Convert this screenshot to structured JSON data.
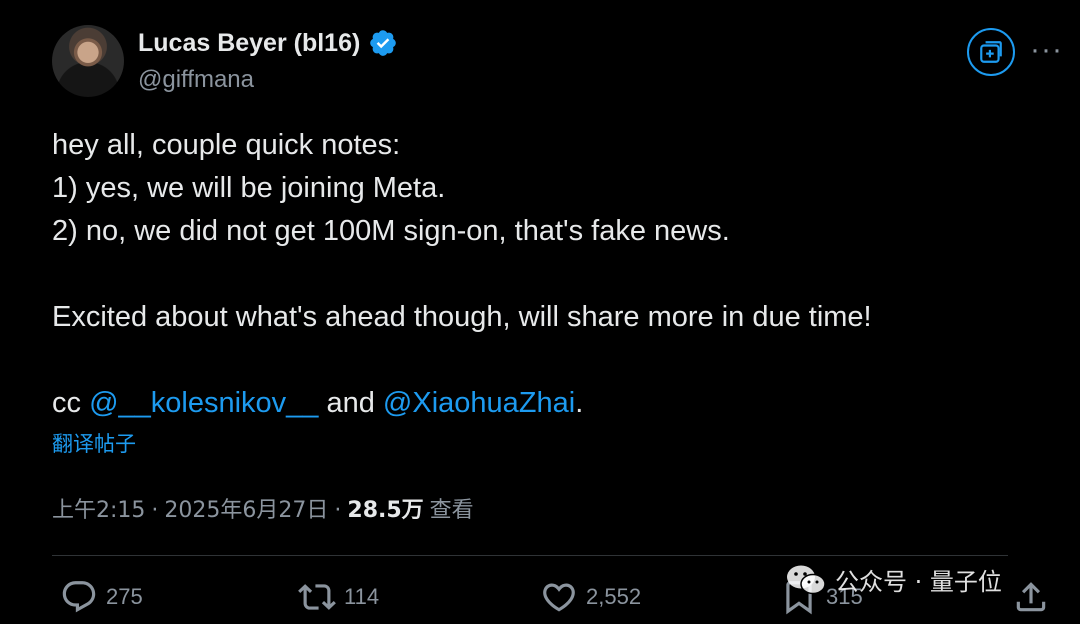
{
  "author": {
    "display_name": "Lucas Beyer (bl16)",
    "handle": "@giffmana"
  },
  "tweet": {
    "line1": "hey all, couple quick notes:",
    "line2": "1) yes, we will be joining Meta.",
    "line3": "2) no, we did not get 100M sign-on, that's fake news.",
    "line5": "Excited about what's ahead though, will share more in due time!",
    "cc_prefix": "cc ",
    "mention1": "@__kolesnikov__",
    "cc_and": " and ",
    "mention2": "@XiaohuaZhai",
    "cc_suffix": "."
  },
  "translate_label": "翻译帖子",
  "meta": {
    "time": "上午2:15",
    "sep1": "·",
    "date": "2025年6月27日",
    "sep2": "·",
    "views": "28.5万",
    "views_label": "查看"
  },
  "actions": {
    "replies": "275",
    "reposts": "114",
    "likes": "2,552",
    "bookmarks": "315"
  },
  "watermark": {
    "text": "公众号 · 量子位"
  },
  "colors": {
    "background": "#000000",
    "text": "#e7e9ea",
    "secondary": "#8b949e",
    "accent": "#1d9bf0"
  },
  "icons": [
    "verified-badge-icon",
    "subscribe-icon",
    "more-icon",
    "reply-icon",
    "repost-icon",
    "like-icon",
    "bookmark-icon",
    "share-icon",
    "wechat-icon"
  ]
}
